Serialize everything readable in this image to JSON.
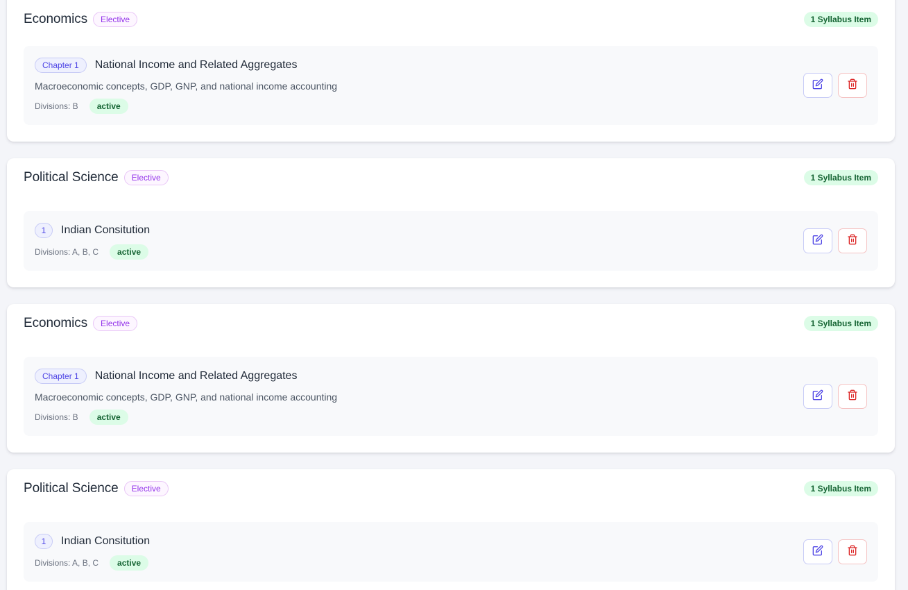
{
  "cards": [
    {
      "subject": "Economics",
      "tag": "Elective",
      "count_label": "1 Syllabus Item",
      "item": {
        "chapter": "Chapter 1",
        "title": "National Income and Related Aggregates",
        "description": "Macroeconomic concepts, GDP, GNP, and national income accounting",
        "divisions": "Divisions: B",
        "status": "active"
      }
    },
    {
      "subject": "Political Science",
      "tag": "Elective",
      "count_label": "1 Syllabus Item",
      "item": {
        "chapter": "1",
        "title": "Indian Consitution",
        "divisions": "Divisions: A, B, C",
        "status": "active"
      }
    },
    {
      "subject": "Economics",
      "tag": "Elective",
      "count_label": "1 Syllabus Item",
      "item": {
        "chapter": "Chapter 1",
        "title": "National Income and Related Aggregates",
        "description": "Macroeconomic concepts, GDP, GNP, and national income accounting",
        "divisions": "Divisions: B",
        "status": "active"
      }
    },
    {
      "subject": "Political Science",
      "tag": "Elective",
      "count_label": "1 Syllabus Item",
      "item": {
        "chapter": "1",
        "title": "Indian Consitution",
        "divisions": "Divisions: A, B, C",
        "status": "active"
      }
    }
  ],
  "icons": {
    "edit": "edit-icon",
    "delete": "trash-icon"
  },
  "colors": {
    "accent": "#4f46e5",
    "elective": "#9333ea",
    "success_bg": "#dcfce7",
    "success_text": "#166534",
    "danger": "#dc2626"
  }
}
